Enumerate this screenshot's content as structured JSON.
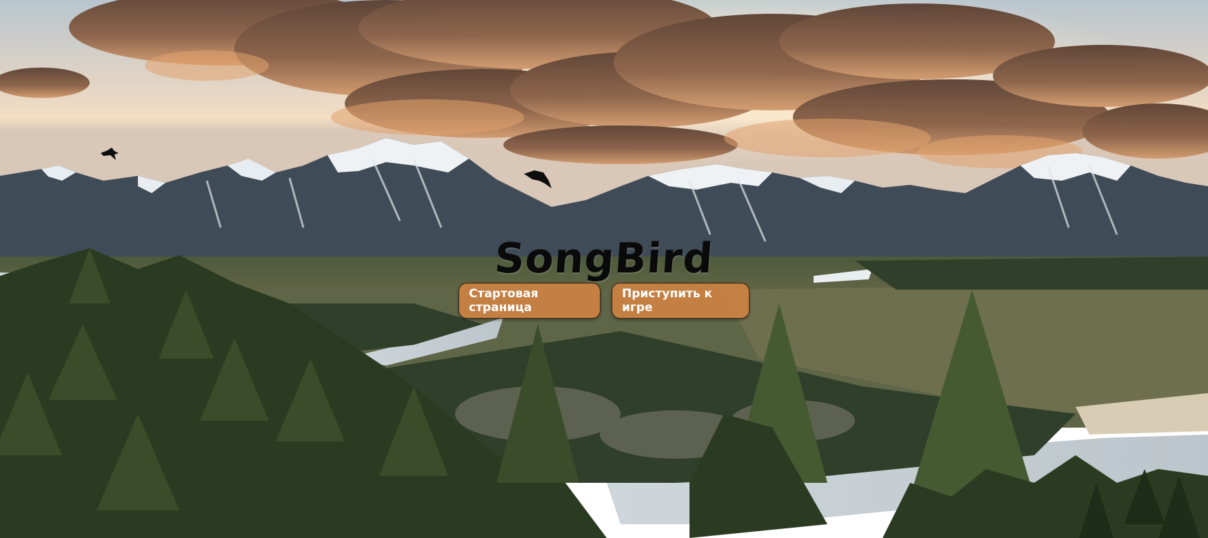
{
  "hero": {
    "title": "SongBird"
  },
  "nav": {
    "start_label": "Стартовая страница",
    "play_label": "Приступить к игре"
  },
  "colors": {
    "button_fill": "#d68442",
    "button_border": "#3a2414",
    "title_color": "#0a0a0a"
  },
  "icons": [
    "bird-icon",
    "bird-icon"
  ]
}
